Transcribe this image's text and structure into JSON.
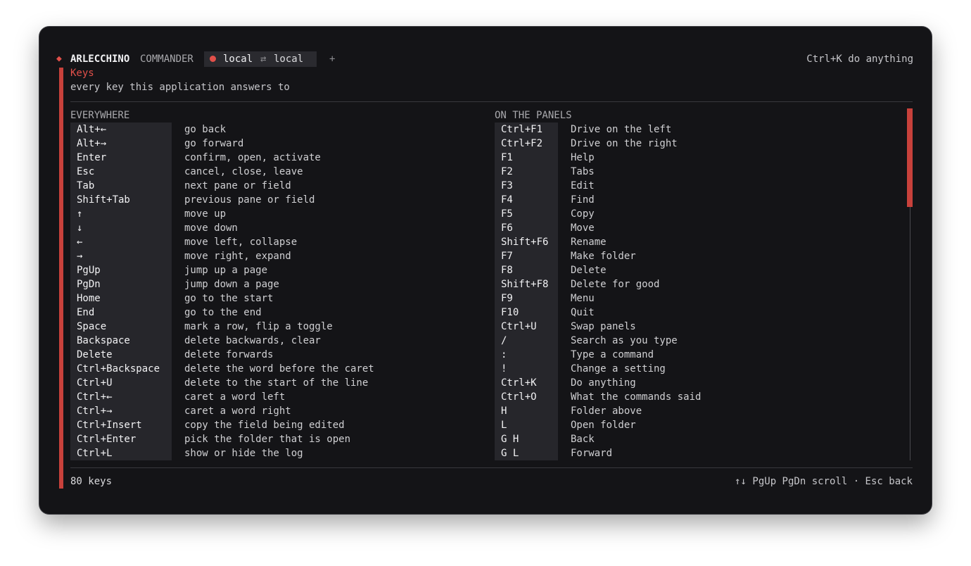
{
  "header": {
    "brand": "ARLECCHINO",
    "brand_sub": "COMMANDER",
    "tab": {
      "left": "local",
      "arrow": "⇄",
      "right": "local"
    },
    "add_tab": "+",
    "anything_hint": "Ctrl+K do anything"
  },
  "panel": {
    "title": "Keys",
    "subtitle": "every key this application answers to"
  },
  "sections": {
    "everywhere": {
      "title": "EVERYWHERE",
      "rows": [
        {
          "key": "Alt+←",
          "desc": "go back"
        },
        {
          "key": "Alt+→",
          "desc": "go forward"
        },
        {
          "key": "Enter",
          "desc": "confirm, open, activate"
        },
        {
          "key": "Esc",
          "desc": "cancel, close, leave"
        },
        {
          "key": "Tab",
          "desc": "next pane or field"
        },
        {
          "key": "Shift+Tab",
          "desc": "previous pane or field"
        },
        {
          "key": "↑",
          "desc": "move up"
        },
        {
          "key": "↓",
          "desc": "move down"
        },
        {
          "key": "←",
          "desc": "move left, collapse"
        },
        {
          "key": "→",
          "desc": "move right, expand"
        },
        {
          "key": "PgUp",
          "desc": "jump up a page"
        },
        {
          "key": "PgDn",
          "desc": "jump down a page"
        },
        {
          "key": "Home",
          "desc": "go to the start"
        },
        {
          "key": "End",
          "desc": "go to the end"
        },
        {
          "key": "Space",
          "desc": "mark a row, flip a toggle"
        },
        {
          "key": "Backspace",
          "desc": "delete backwards, clear"
        },
        {
          "key": "Delete",
          "desc": "delete forwards"
        },
        {
          "key": "Ctrl+Backspace",
          "desc": "delete the word before the caret"
        },
        {
          "key": "Ctrl+U",
          "desc": "delete to the start of the line"
        },
        {
          "key": "Ctrl+←",
          "desc": "caret a word left"
        },
        {
          "key": "Ctrl+→",
          "desc": "caret a word right"
        },
        {
          "key": "Ctrl+Insert",
          "desc": "copy the field being edited"
        },
        {
          "key": "Ctrl+Enter",
          "desc": "pick the folder that is open"
        },
        {
          "key": "Ctrl+L",
          "desc": "show or hide the log"
        }
      ]
    },
    "panels": {
      "title": "ON THE PANELS",
      "rows": [
        {
          "key": "Ctrl+F1",
          "desc": "Drive on the left"
        },
        {
          "key": "Ctrl+F2",
          "desc": "Drive on the right"
        },
        {
          "key": "F1",
          "desc": "Help"
        },
        {
          "key": "F2",
          "desc": "Tabs"
        },
        {
          "key": "F3",
          "desc": "Edit"
        },
        {
          "key": "F4",
          "desc": "Find"
        },
        {
          "key": "F5",
          "desc": "Copy"
        },
        {
          "key": "F6",
          "desc": "Move"
        },
        {
          "key": "Shift+F6",
          "desc": "Rename"
        },
        {
          "key": "F7",
          "desc": "Make folder"
        },
        {
          "key": "F8",
          "desc": "Delete"
        },
        {
          "key": "Shift+F8",
          "desc": "Delete for good"
        },
        {
          "key": "F9",
          "desc": "Menu"
        },
        {
          "key": "F10",
          "desc": "Quit"
        },
        {
          "key": "Ctrl+U",
          "desc": "Swap panels"
        },
        {
          "key": "/",
          "desc": "Search as you type"
        },
        {
          "key": ":",
          "desc": "Type a command"
        },
        {
          "key": "!",
          "desc": "Change a setting"
        },
        {
          "key": "Ctrl+K",
          "desc": "Do anything"
        },
        {
          "key": "Ctrl+O",
          "desc": "What the commands said"
        },
        {
          "key": "H",
          "desc": "Folder above"
        },
        {
          "key": "L",
          "desc": "Open folder"
        },
        {
          "key": "G H",
          "desc": "Back"
        },
        {
          "key": "G L",
          "desc": "Forward"
        }
      ]
    }
  },
  "footer": {
    "count": "80 keys",
    "hint": "↑↓ PgUp PgDn scroll · Esc back"
  },
  "colors": {
    "accent": "#e2504a",
    "background": "#141417",
    "key_cell": "#26262b"
  }
}
